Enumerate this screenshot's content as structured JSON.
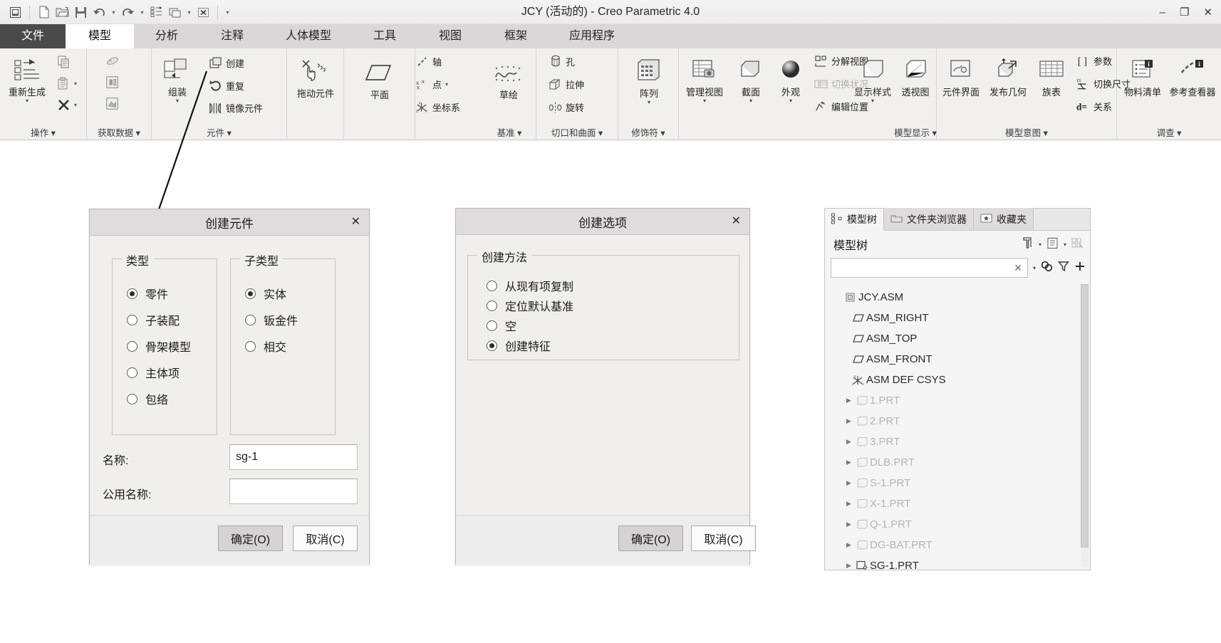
{
  "window": {
    "title": "JCY (活动的) - Creo Parametric 4.0",
    "minimize": "–",
    "maximize": "❐",
    "close": "✕"
  },
  "quick_access": {
    "icons": [
      "window-icon",
      "new-file-icon",
      "open-folder-icon",
      "save-icon",
      "undo-icon",
      "redo-icon",
      "regenerate-icon",
      "window-switch-icon",
      "close-window-icon",
      "customize-qat-icon"
    ]
  },
  "tabs": [
    {
      "label": "文件",
      "state": "file"
    },
    {
      "label": "模型",
      "state": "active"
    },
    {
      "label": "分析",
      "state": "normal"
    },
    {
      "label": "注释",
      "state": "normal"
    },
    {
      "label": "人体模型",
      "state": "normal"
    },
    {
      "label": "工具",
      "state": "normal"
    },
    {
      "label": "视图",
      "state": "normal"
    },
    {
      "label": "框架",
      "state": "normal"
    },
    {
      "label": "应用程序",
      "state": "normal"
    }
  ],
  "tab_right_icons": [
    "collapse-ribbon-icon",
    "search-icon",
    "account-icon",
    "help-icon"
  ],
  "ribbon": {
    "groups": [
      {
        "name": "操作",
        "label": "操作 ▾",
        "big": [
          {
            "label": "重新生成",
            "icon": "regenerate-icon",
            "dropdown": "▾"
          }
        ],
        "small": [
          {
            "label": "",
            "icon": "copy-icon"
          },
          {
            "label": "",
            "icon": "paste-icon",
            "dropdown": "▾"
          },
          {
            "label": "",
            "icon": "delete-x-icon",
            "dropdown": "▾"
          }
        ]
      },
      {
        "name": "获取数据",
        "label": "获取数据 ▾",
        "small": [
          {
            "label": "",
            "icon": "import-icon"
          },
          {
            "label": "",
            "icon": "merge-icon"
          },
          {
            "label": "",
            "icon": "shrinkwrap-icon"
          }
        ]
      },
      {
        "name": "元件",
        "label": "元件 ▾",
        "big": [
          {
            "label": "组装",
            "icon": "assemble-icon",
            "dropdown": "▾"
          }
        ],
        "small": [
          {
            "label": "创建",
            "icon": "create-component-icon"
          },
          {
            "label": "重复",
            "icon": "repeat-icon"
          },
          {
            "label": "镜像元件",
            "icon": "mirror-component-icon"
          }
        ]
      },
      {
        "name": "拖动元件",
        "label": "",
        "big": [
          {
            "label": "拖动元件",
            "icon": "drag-component-icon"
          }
        ]
      },
      {
        "name": "基准",
        "label": "基准 ▾",
        "big": [
          {
            "label": "平面",
            "icon": "datum-plane-icon"
          },
          {
            "label": "草绘",
            "icon": "sketch-icon"
          }
        ],
        "small": [
          {
            "label": "轴",
            "icon": "datum-axis-icon"
          },
          {
            "label": "点",
            "icon": "datum-point-icon",
            "dropdown": "▾"
          },
          {
            "label": "坐标系",
            "icon": "coordinate-system-icon"
          }
        ]
      },
      {
        "name": "切口和曲面",
        "label": "切口和曲面 ▾",
        "small": [
          {
            "label": "孔",
            "icon": "hole-icon"
          },
          {
            "label": "拉伸",
            "icon": "extrude-icon"
          },
          {
            "label": "旋转",
            "icon": "revolve-icon"
          }
        ]
      },
      {
        "name": "修饰符",
        "label": "修饰符 ▾",
        "big": [
          {
            "label": "阵列",
            "icon": "pattern-icon",
            "dropdown": "▾"
          }
        ]
      },
      {
        "name": "模型显示",
        "label": "模型显示 ▾",
        "big": [
          {
            "label": "管理视图",
            "icon": "manage-views-icon",
            "dropdown": "▾"
          },
          {
            "label": "截面",
            "icon": "section-icon",
            "dropdown": "▾"
          },
          {
            "label": "外观",
            "icon": "appearance-icon",
            "dropdown": "▾"
          },
          {
            "label": "显示样式",
            "icon": "display-style-icon",
            "dropdown": "▾"
          },
          {
            "label": "透视图",
            "icon": "perspective-icon"
          }
        ],
        "small": [
          {
            "label": "分解视图",
            "icon": "explode-view-icon"
          },
          {
            "label": "切换状况",
            "icon": "toggle-status-icon",
            "disabled": true
          },
          {
            "label": "编辑位置",
            "icon": "edit-position-icon"
          }
        ]
      },
      {
        "name": "模型意图",
        "label": "模型意图 ▾",
        "big": [
          {
            "label": "元件界面",
            "icon": "component-interface-icon"
          },
          {
            "label": "发布几何",
            "icon": "publish-geometry-icon"
          },
          {
            "label": "族表",
            "icon": "family-table-icon"
          }
        ],
        "small": [
          {
            "label": "参数",
            "icon": "parameters-icon"
          },
          {
            "label": "切换尺寸",
            "icon": "switch-dimensions-icon"
          },
          {
            "label": "关系",
            "icon": "relations-icon"
          }
        ]
      },
      {
        "name": "调查",
        "label": "调查 ▾",
        "big": [
          {
            "label": "物料清单",
            "icon": "bom-icon"
          },
          {
            "label": "参考查看器",
            "icon": "reference-viewer-icon"
          }
        ]
      }
    ]
  },
  "dialog_create_component": {
    "title": "创建元件",
    "close": "✕",
    "type_group": {
      "legend": "类型",
      "options": [
        {
          "label": "零件",
          "selected": true
        },
        {
          "label": "子装配",
          "selected": false
        },
        {
          "label": "骨架模型",
          "selected": false
        },
        {
          "label": "主体项",
          "selected": false
        },
        {
          "label": "包络",
          "selected": false
        }
      ]
    },
    "subtype_group": {
      "legend": "子类型",
      "options": [
        {
          "label": "实体",
          "selected": true
        },
        {
          "label": "钣金件",
          "selected": false
        },
        {
          "label": "相交",
          "selected": false
        }
      ]
    },
    "fields": [
      {
        "label": "名称:",
        "value": "sg-1",
        "placeholder": ""
      },
      {
        "label": "公用名称:",
        "value": "",
        "placeholder": ""
      }
    ],
    "buttons": [
      {
        "label": "确定(O)",
        "style": "primary"
      },
      {
        "label": "取消(C)",
        "style": "secondary"
      }
    ]
  },
  "dialog_creation_options": {
    "title": "创建选项",
    "close": "✕",
    "method_group": {
      "legend": "创建方法",
      "options": [
        {
          "label": "从现有项复制",
          "selected": false
        },
        {
          "label": "定位默认基准",
          "selected": false
        },
        {
          "label": "空",
          "selected": false
        },
        {
          "label": "创建特征",
          "selected": true
        }
      ]
    },
    "buttons": [
      {
        "label": "确定(O)",
        "style": "primary"
      },
      {
        "label": "取消(C)",
        "style": "secondary"
      }
    ]
  },
  "model_tree": {
    "tabs": [
      {
        "label": "模型树",
        "icon": "model-tree-icon",
        "active": true
      },
      {
        "label": "文件夹浏览器",
        "icon": "folder-browser-icon",
        "active": false
      },
      {
        "label": "收藏夹",
        "icon": "favorites-icon",
        "active": false
      }
    ],
    "header": "模型树",
    "header_icons": [
      "tree-filters-icon",
      "tree-filters-dropdown-icon",
      "settings-icon",
      "settings-dropdown-icon",
      "display-icon"
    ],
    "search": {
      "value": "",
      "placeholder": "",
      "clear": "✕"
    },
    "search_icons": [
      "search-dropdown-icon",
      "find-icon",
      "filter-icon",
      "add-icon"
    ],
    "items": [
      {
        "label": "JCY.ASM",
        "icon": "assembly-icon",
        "indent": 0,
        "arrow": false,
        "dim": false
      },
      {
        "label": "ASM_RIGHT",
        "icon": "datum-plane-icon",
        "indent": 1,
        "arrow": false,
        "dim": false
      },
      {
        "label": "ASM_TOP",
        "icon": "datum-plane-icon",
        "indent": 1,
        "arrow": false,
        "dim": false
      },
      {
        "label": "ASM_FRONT",
        "icon": "datum-plane-icon",
        "indent": 1,
        "arrow": false,
        "dim": false
      },
      {
        "label": "ASM DEF CSYS",
        "icon": "coordinate-system-icon",
        "indent": 1,
        "arrow": false,
        "dim": false
      },
      {
        "label": "1.PRT",
        "icon": "part-icon",
        "indent": 1,
        "arrow": true,
        "dim": true
      },
      {
        "label": "2.PRT",
        "icon": "part-icon",
        "indent": 1,
        "arrow": true,
        "dim": true
      },
      {
        "label": "3.PRT",
        "icon": "part-icon",
        "indent": 1,
        "arrow": true,
        "dim": true
      },
      {
        "label": "DLB.PRT",
        "icon": "part-icon",
        "indent": 1,
        "arrow": true,
        "dim": true
      },
      {
        "label": "S-1.PRT",
        "icon": "part-icon",
        "indent": 1,
        "arrow": true,
        "dim": true
      },
      {
        "label": "X-1.PRT",
        "icon": "part-icon",
        "indent": 1,
        "arrow": true,
        "dim": true
      },
      {
        "label": "Q-1.PRT",
        "icon": "part-icon",
        "indent": 1,
        "arrow": true,
        "dim": true
      },
      {
        "label": "DG-BAT.PRT",
        "icon": "part-icon",
        "indent": 1,
        "arrow": true,
        "dim": true
      },
      {
        "label": "SG-1.PRT",
        "icon": "part-active-icon",
        "indent": 1,
        "arrow": true,
        "dim": false
      }
    ]
  },
  "annotation": {
    "type": "arrow",
    "from_icon": "create-component-icon",
    "to": "dialog-create-component"
  }
}
